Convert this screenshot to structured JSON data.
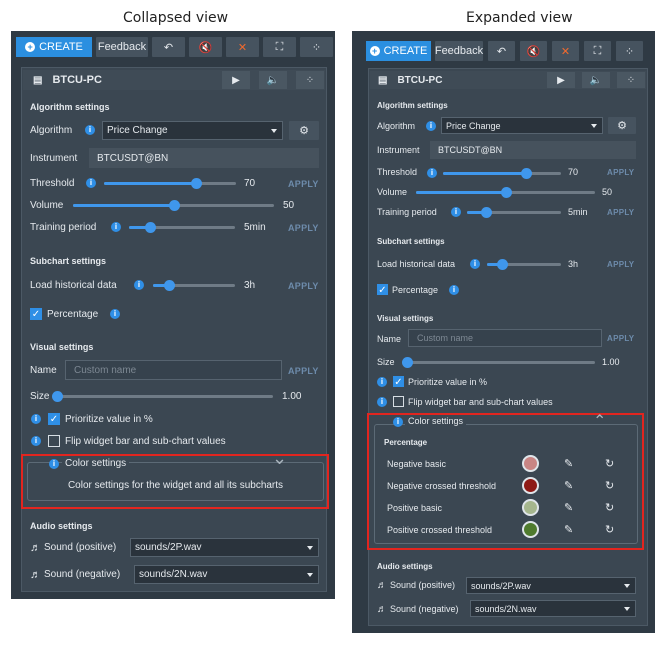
{
  "captions": {
    "left": "Collapsed view",
    "right": "Expanded view"
  },
  "toolbar": {
    "create": "CREATE",
    "feedback": "Feedback",
    "undo": "↶",
    "mute": "🔇",
    "close": "✕",
    "expand": "⛶",
    "drag": "⁘"
  },
  "widget": {
    "title": "BTCU-PC",
    "play": "▶",
    "sound": "🔈",
    "move": "⁘"
  },
  "algo": {
    "section": "Algorithm settings",
    "algorithm_label": "Algorithm",
    "algorithm_value": "Price Change",
    "gear": "⚙",
    "instrument_label": "Instrument",
    "instrument_value": "BTCUSDT@BN",
    "threshold_label": "Threshold",
    "threshold_value": "70",
    "volume_label": "Volume",
    "volume_value": "50",
    "training_label": "Training period",
    "training_value": "5min",
    "apply": "APPLY"
  },
  "slider_levels": {
    "threshold": 0.7,
    "volume": 0.5,
    "training": 0.2,
    "historical": 0.2,
    "size": 0.0
  },
  "subchart": {
    "section": "Subchart settings",
    "historical_label": "Load historical data",
    "historical_value": "3h",
    "percentage_label": "Percentage",
    "check": "✓"
  },
  "visual": {
    "section": "Visual settings",
    "name_label": "Name",
    "name_placeholder": "Custom name",
    "size_label": "Size",
    "size_value": "1.00",
    "prioritize_label": "Prioritize value in %",
    "flip_label": "Flip widget bar and sub-chart values"
  },
  "color": {
    "title": "Color settings",
    "chevron_down": "⌄",
    "chevron_up": "⌃",
    "description": "Color settings for the widget and all its subcharts",
    "group": "Percentage",
    "rows": [
      {
        "label": "Negative basic",
        "color": "#c98584"
      },
      {
        "label": "Negative crossed threshold",
        "color": "#8e1a16"
      },
      {
        "label": "Positive basic",
        "color": "#a5b68d"
      },
      {
        "label": "Positive crossed threshold",
        "color": "#4f7b2e"
      }
    ],
    "pick": "✎",
    "reset": "↻"
  },
  "audio": {
    "section": "Audio settings",
    "pos_label": "Sound (positive)",
    "pos_value": "sounds/2P.wav",
    "neg_label": "Sound (negative)",
    "neg_value": "sounds/2N.wav",
    "note_icon": "♬"
  },
  "colors": {
    "panel": "#2f3a44",
    "accent": "#2f8fe6",
    "highlight": "#e2251f"
  }
}
